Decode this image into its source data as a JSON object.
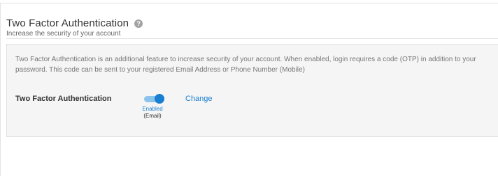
{
  "header": {
    "title": "Two Factor Authentication",
    "help_icon": "help-question-icon",
    "subtitle": "Increase the security of your account"
  },
  "panel": {
    "description": "Two Factor Authentication is an additional feature to increase security of your account. When enabled, login requires a code (OTP) in addition to your password. This code can be sent to your registered Email Address or Phone Number (Mobile)",
    "field_label": "Two Factor Authentication",
    "toggle": {
      "state": "on",
      "status_text": "Enabled",
      "method_text": "(Email)"
    },
    "change_link": "Change"
  },
  "colors": {
    "accent": "#1a7fd1",
    "toggle_track": "#8bc4ea",
    "panel_background": "#f5f5f5"
  }
}
